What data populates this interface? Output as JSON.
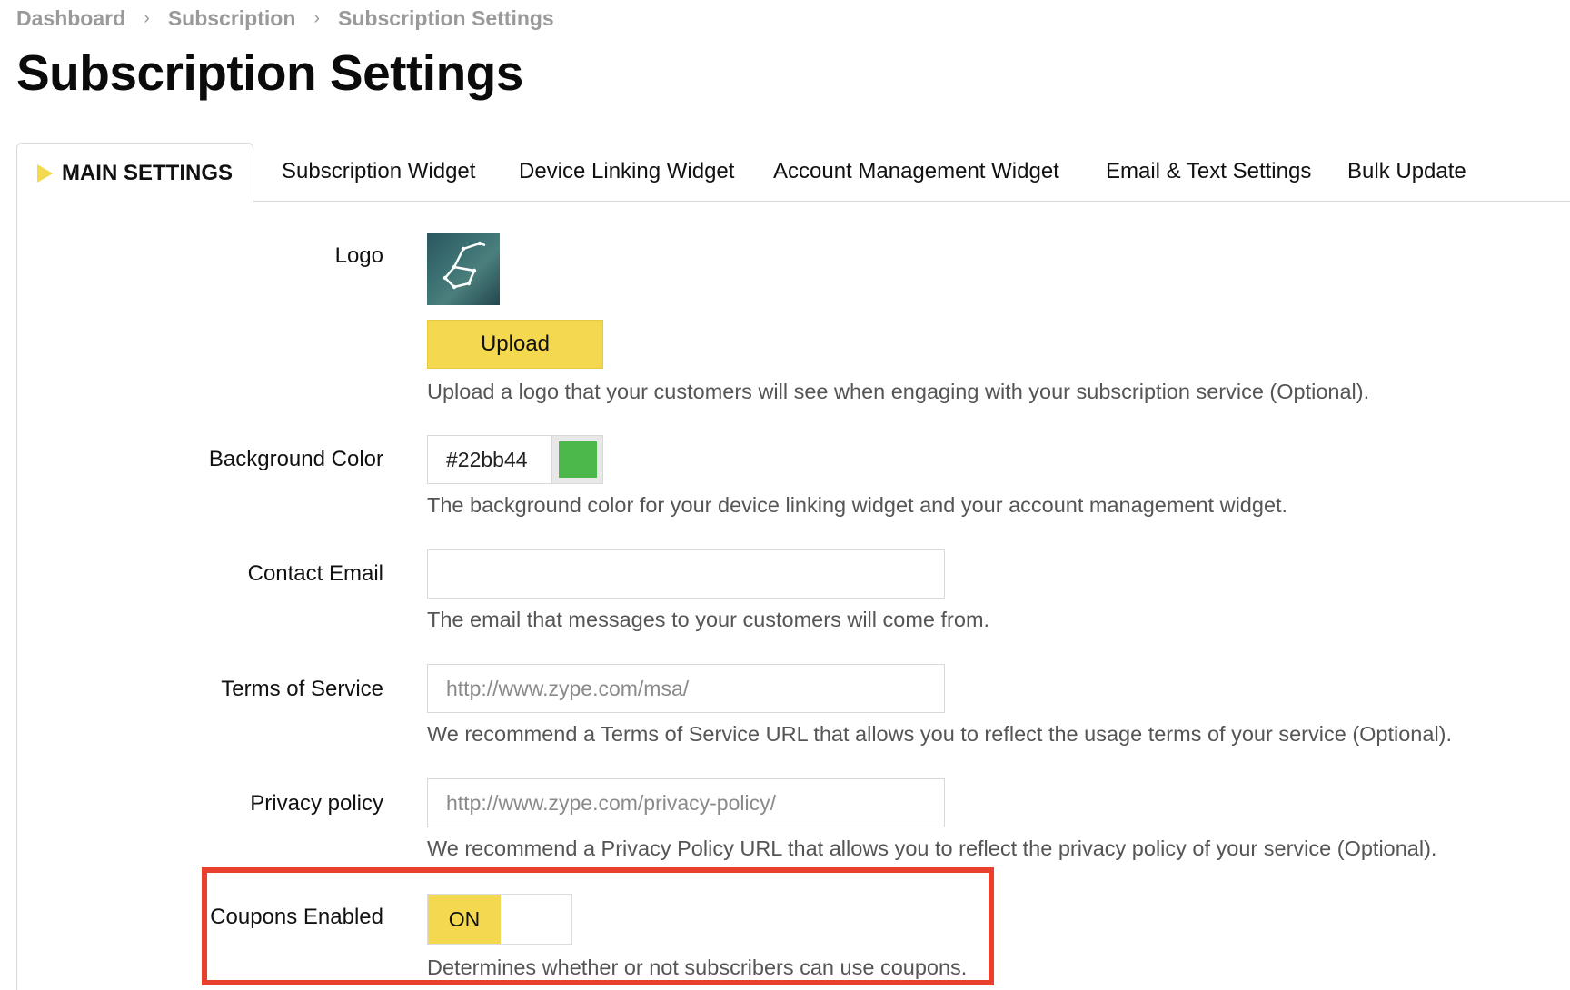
{
  "breadcrumb": {
    "items": [
      "Dashboard",
      "Subscription",
      "Subscription Settings"
    ],
    "separator": "›"
  },
  "page": {
    "title": "Subscription Settings"
  },
  "tabs": [
    {
      "label": "MAIN SETTINGS",
      "active": true
    },
    {
      "label": "Subscription Widget",
      "active": false
    },
    {
      "label": "Device Linking Widget",
      "active": false
    },
    {
      "label": "Account Management Widget",
      "active": false
    },
    {
      "label": "Email & Text Settings",
      "active": false
    },
    {
      "label": "Bulk Update",
      "active": false
    }
  ],
  "form": {
    "logo": {
      "label": "Logo",
      "upload_label": "Upload",
      "help": "Upload a logo that your customers will see when engaging with your subscription service (Optional)."
    },
    "background_color": {
      "label": "Background Color",
      "value": "#22bb44",
      "swatch_color": "#4cb84c",
      "help": "The background color for your device linking widget and your account management widget."
    },
    "contact_email": {
      "label": "Contact Email",
      "value": "",
      "help": "The email that messages to your customers will come from."
    },
    "terms_of_service": {
      "label": "Terms of Service",
      "placeholder": "http://www.zype.com/msa/",
      "help": "We recommend a Terms of Service URL that allows you to reflect the usage terms of your service (Optional)."
    },
    "privacy_policy": {
      "label": "Privacy policy",
      "placeholder": "http://www.zype.com/privacy-policy/",
      "help": "We recommend a Privacy Policy URL that allows you to reflect the privacy policy of your service (Optional)."
    },
    "coupons_enabled": {
      "label": "Coupons Enabled",
      "state": "ON",
      "help": "Determines whether or not subscribers can use coupons."
    }
  },
  "colors": {
    "accent_yellow": "#f4d84f",
    "highlight_red": "#e8402c"
  }
}
